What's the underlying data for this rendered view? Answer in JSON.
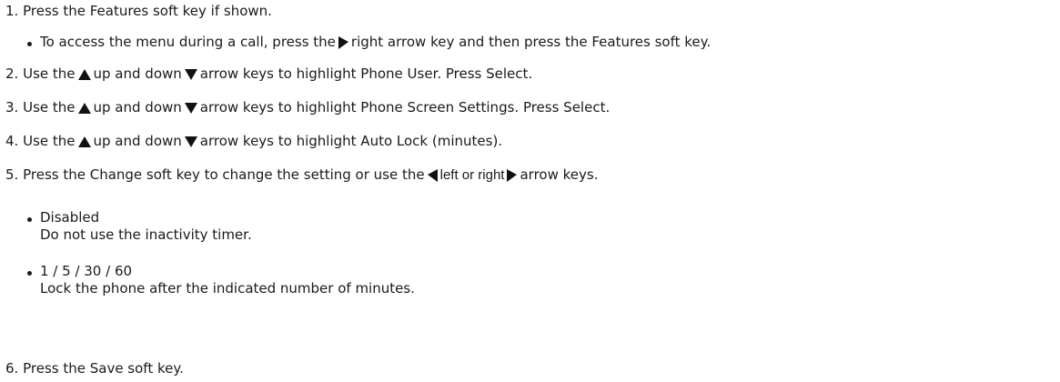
{
  "steps": [
    {
      "number": "1.",
      "text": "Press the Features soft key if shown.",
      "sub": {
        "pre": "To access the menu during a call, press the",
        "post": "right arrow key and then press the Features soft key."
      }
    },
    {
      "number": "2.",
      "pre": "Use the",
      "mid": "up and down",
      "post": "arrow keys to highlight Phone User. Press Select."
    },
    {
      "number": "3.",
      "pre": "Use the",
      "mid": "up and down",
      "post": "arrow keys to highlight Phone Screen Settings. Press Select."
    },
    {
      "number": "4.",
      "pre": "Use the",
      "mid": "up and down",
      "post": "arrow keys to highlight Auto Lock (minutes)."
    },
    {
      "number": "5.",
      "pre": "Press the Change soft key to change the setting or use the",
      "mid": "left or right",
      "post": "arrow keys.",
      "options": [
        {
          "title": "Disabled",
          "desc": "Do not use the inactivity timer."
        },
        {
          "title": "1 / 5 / 30 / 60",
          "desc": "Lock the phone after the indicated number of minutes."
        }
      ]
    },
    {
      "number": "6.",
      "text": "Press the Save soft key."
    }
  ],
  "icons": {
    "right": "right-arrow-icon",
    "up": "up-arrow-icon",
    "down": "down-arrow-icon",
    "left": "left-arrow-icon"
  }
}
